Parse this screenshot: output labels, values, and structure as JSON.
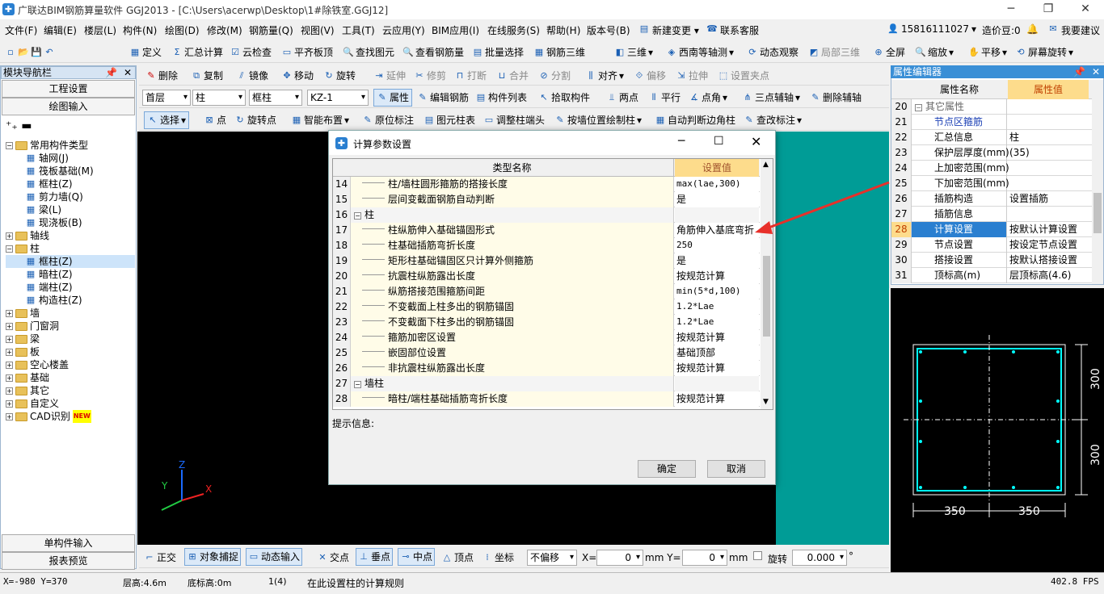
{
  "window": {
    "title": "广联达BIM钢筋算量软件 GGJ2013 - [C:\\Users\\acerwp\\Desktop\\1#除铁室.GGJ12]",
    "minimize": "─",
    "maximize": "❐",
    "close": "✕"
  },
  "menu": [
    "文件(F)",
    "编辑(E)",
    "楼层(L)",
    "构件(N)",
    "绘图(D)",
    "修改(M)",
    "钢筋量(Q)",
    "视图(V)",
    "工具(T)",
    "云应用(Y)",
    "BIM应用(I)",
    "在线服务(S)",
    "帮助(H)",
    "版本号(B)",
    "新建变更 ▾",
    "联系客服"
  ],
  "user": {
    "phone": "15816111027",
    "dou": "造价豆:0",
    "suggest": "我要建议"
  },
  "toolbar1": [
    "定义",
    "汇总计算",
    "云检查",
    "平齐板顶",
    "查找图元",
    "查看钢筋量",
    "批量选择",
    "钢筋三维",
    "三维",
    "西南等轴测",
    "动态观察",
    "局部三维",
    "全屏",
    "缩放",
    "平移",
    "屏幕旋转"
  ],
  "toolbar2": [
    "删除",
    "复制",
    "镜像",
    "移动",
    "旋转",
    "延伸",
    "修剪",
    "打断",
    "合并",
    "分割",
    "对齐",
    "偏移",
    "拉伸",
    "设置夹点"
  ],
  "toolbar3": {
    "floor": "首层",
    "type": "柱",
    "subtype": "框柱",
    "member": "KZ-1",
    "items": [
      "属性",
      "编辑钢筋",
      "构件列表",
      "拾取构件",
      "两点",
      "平行",
      "点角",
      "三点辅轴",
      "删除辅轴"
    ]
  },
  "toolbar4": [
    "选择",
    "点",
    "旋转点",
    "智能布置",
    "原位标注",
    "图元柱表",
    "调整柱端头",
    "按墙位置绘制柱",
    "自动判断边角柱",
    "查改标注"
  ],
  "nav": {
    "header": "模块导航栏",
    "btn1": "工程设置",
    "btn2": "绘图输入",
    "btn3": "单构件输入",
    "btn4": "报表预览",
    "tree": [
      {
        "label": "常用构件类型",
        "level": 0,
        "exp": "−",
        "folder": true
      },
      {
        "label": "轴网(J)",
        "level": 1
      },
      {
        "label": "筏板基础(M)",
        "level": 1
      },
      {
        "label": "框柱(Z)",
        "level": 1
      },
      {
        "label": "剪力墙(Q)",
        "level": 1
      },
      {
        "label": "梁(L)",
        "level": 1
      },
      {
        "label": "现浇板(B)",
        "level": 1
      },
      {
        "label": "轴线",
        "level": 0,
        "exp": "+",
        "folder": true
      },
      {
        "label": "柱",
        "level": 0,
        "exp": "−",
        "folder": true
      },
      {
        "label": "框柱(Z)",
        "level": 1,
        "selected": true
      },
      {
        "label": "暗柱(Z)",
        "level": 1
      },
      {
        "label": "端柱(Z)",
        "level": 1
      },
      {
        "label": "构造柱(Z)",
        "level": 1
      },
      {
        "label": "墙",
        "level": 0,
        "exp": "+",
        "folder": true
      },
      {
        "label": "门窗洞",
        "level": 0,
        "exp": "+",
        "folder": true
      },
      {
        "label": "梁",
        "level": 0,
        "exp": "+",
        "folder": true
      },
      {
        "label": "板",
        "level": 0,
        "exp": "+",
        "folder": true
      },
      {
        "label": "空心楼盖",
        "level": 0,
        "exp": "+",
        "folder": true
      },
      {
        "label": "基础",
        "level": 0,
        "exp": "+",
        "folder": true
      },
      {
        "label": "其它",
        "level": 0,
        "exp": "+",
        "folder": true
      },
      {
        "label": "自定义",
        "level": 0,
        "exp": "+",
        "folder": true
      },
      {
        "label": "CAD识别",
        "level": 0,
        "exp": "+",
        "folder": true,
        "badge": "NEW"
      }
    ]
  },
  "dialog": {
    "title": "计算参数设置",
    "col_name": "类型名称",
    "col_value": "设置值",
    "hint": "提示信息:",
    "ok": "确定",
    "cancel": "取消",
    "rows": [
      {
        "n": "14",
        "name": "柱/墙柱圆形箍筋的搭接长度",
        "value": "max(lae,300)",
        "group": false
      },
      {
        "n": "15",
        "name": "层间变截面钢筋自动判断",
        "value": "是",
        "group": false
      },
      {
        "n": "16",
        "name": "柱",
        "value": "",
        "group": true
      },
      {
        "n": "17",
        "name": "柱纵筋伸入基础锚固形式",
        "value": "角筋伸入基底弯折",
        "group": false
      },
      {
        "n": "18",
        "name": "柱基础插筋弯折长度",
        "value": "250",
        "group": false
      },
      {
        "n": "19",
        "name": "矩形柱基础锚固区只计算外侧箍筋",
        "value": "是",
        "group": false
      },
      {
        "n": "20",
        "name": "抗震柱纵筋露出长度",
        "value": "按规范计算",
        "group": false
      },
      {
        "n": "21",
        "name": "纵筋搭接范围箍筋间距",
        "value": "min(5*d,100)",
        "group": false
      },
      {
        "n": "22",
        "name": "不变截面上柱多出的钢筋锚固",
        "value": "1.2*Lae",
        "group": false
      },
      {
        "n": "23",
        "name": "不变截面下柱多出的钢筋锚固",
        "value": "1.2*Lae",
        "group": false
      },
      {
        "n": "24",
        "name": "箍筋加密区设置",
        "value": "按规范计算",
        "group": false
      },
      {
        "n": "25",
        "name": "嵌固部位设置",
        "value": "基础顶部",
        "group": false
      },
      {
        "n": "26",
        "name": "非抗震柱纵筋露出长度",
        "value": "按规范计算",
        "group": false
      },
      {
        "n": "27",
        "name": "墙柱",
        "value": "",
        "group": true
      },
      {
        "n": "28",
        "name": "暗柱/端柱基础插筋弯折长度",
        "value": "按规范计算",
        "group": false
      }
    ]
  },
  "props": {
    "header": "属性编辑器",
    "col_name": "属性名称",
    "col_value": "属性值",
    "rows": [
      {
        "n": "20",
        "name": "其它属性",
        "value": "",
        "group": true
      },
      {
        "n": "21",
        "name": "节点区箍筋",
        "value": "",
        "blue": true
      },
      {
        "n": "22",
        "name": "汇总信息",
        "value": "柱"
      },
      {
        "n": "23",
        "name": "保护层厚度(mm)",
        "value": "(35)"
      },
      {
        "n": "24",
        "name": "上加密范围(mm)",
        "value": ""
      },
      {
        "n": "25",
        "name": "下加密范围(mm)",
        "value": ""
      },
      {
        "n": "26",
        "name": "插筋构造",
        "value": "设置插筋"
      },
      {
        "n": "27",
        "name": "插筋信息",
        "value": ""
      },
      {
        "n": "28",
        "name": "计算设置",
        "value": "按默认计算设置",
        "selected": true
      },
      {
        "n": "29",
        "name": "节点设置",
        "value": "按设定节点设置"
      },
      {
        "n": "30",
        "name": "搭接设置",
        "value": "按默认搭接设置"
      },
      {
        "n": "31",
        "name": "顶标高(m)",
        "value": "层顶标高(4.6)"
      }
    ]
  },
  "preview": {
    "dim_v1": "300",
    "dim_v2": "300",
    "dim_h1": "350",
    "dim_h2": "350"
  },
  "axes": {
    "x": "X",
    "y": "Y",
    "z": "Z"
  },
  "snapbar": {
    "items": [
      "正交",
      "对象捕捉",
      "动态输入",
      "交点",
      "垂点",
      "中点",
      "顶点",
      "坐标"
    ],
    "offset": "不偏移",
    "x_label": "X=",
    "x_val": "0",
    "y_label": "mm Y=",
    "y_val": "0",
    "mm": "mm",
    "rotate": "旋转",
    "rot_val": "0.000",
    "deg": "°"
  },
  "status": {
    "coords": "X=-980 Y=370",
    "floor_h": "层高:4.6m",
    "base_h": "底标高:0m",
    "count": "1(4)",
    "msg": "在此设置柱的计算规则",
    "fps": "402.8 FPS"
  },
  "colors": {
    "accent": "#1a5fb4",
    "canvas": "#000000",
    "teal": "#009c96",
    "rebar": "#00ffff",
    "arrow": "#e8302a"
  }
}
